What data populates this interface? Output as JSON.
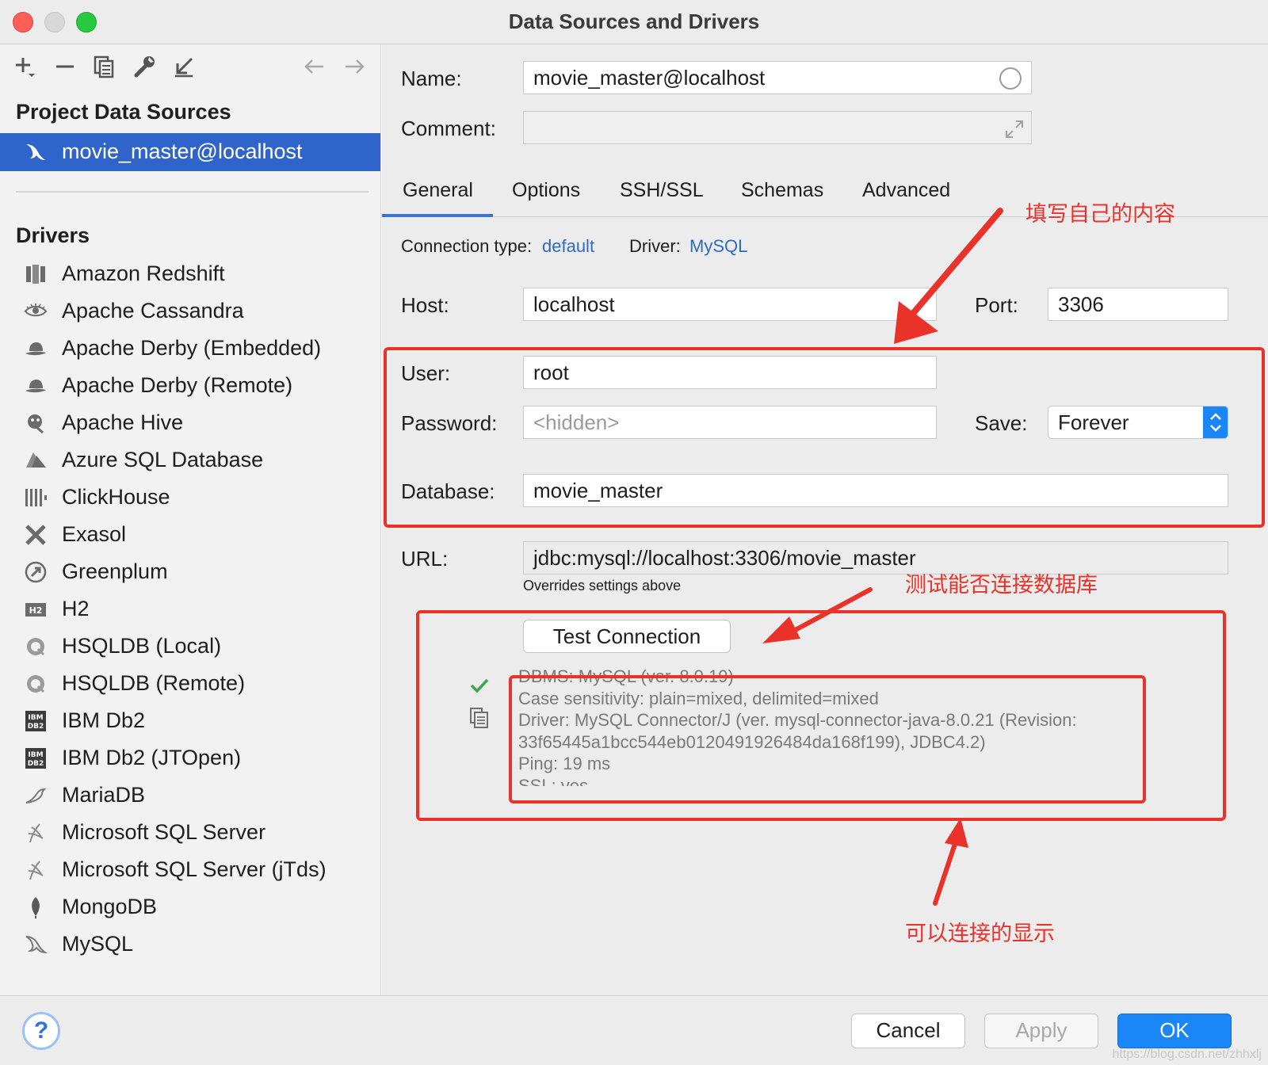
{
  "window": {
    "title": "Data Sources and Drivers"
  },
  "sidebar": {
    "project_header": "Project Data Sources",
    "selected_source": "movie_master@localhost",
    "drivers_header": "Drivers",
    "drivers": [
      {
        "label": "Amazon Redshift",
        "icon": "redshift-icon"
      },
      {
        "label": "Apache Cassandra",
        "icon": "cassandra-eye-icon"
      },
      {
        "label": "Apache Derby (Embedded)",
        "icon": "derby-hat-icon"
      },
      {
        "label": "Apache Derby (Remote)",
        "icon": "derby-hat-icon"
      },
      {
        "label": "Apache Hive",
        "icon": "hive-icon"
      },
      {
        "label": "Azure SQL Database",
        "icon": "azure-icon"
      },
      {
        "label": "ClickHouse",
        "icon": "clickhouse-icon"
      },
      {
        "label": "Exasol",
        "icon": "exasol-icon"
      },
      {
        "label": "Greenplum",
        "icon": "greenplum-icon"
      },
      {
        "label": "H2",
        "icon": "h2-icon"
      },
      {
        "label": "HSQLDB (Local)",
        "icon": "hsqldb-icon"
      },
      {
        "label": "HSQLDB (Remote)",
        "icon": "hsqldb-icon"
      },
      {
        "label": "IBM Db2",
        "icon": "ibm-db2-icon"
      },
      {
        "label": "IBM Db2 (JTOpen)",
        "icon": "ibm-db2-icon"
      },
      {
        "label": "MariaDB",
        "icon": "mariadb-seal-icon"
      },
      {
        "label": "Microsoft SQL Server",
        "icon": "sqlserver-icon"
      },
      {
        "label": "Microsoft SQL Server (jTds)",
        "icon": "sqlserver-icon"
      },
      {
        "label": "MongoDB",
        "icon": "mongodb-leaf-icon"
      },
      {
        "label": "MySQL",
        "icon": "mysql-dolphin-icon"
      }
    ]
  },
  "form": {
    "name_label": "Name:",
    "name_value": "movie_master@localhost",
    "comment_label": "Comment:",
    "comment_value": "",
    "tabs": [
      "General",
      "Options",
      "SSH/SSL",
      "Schemas",
      "Advanced"
    ],
    "active_tab": "General",
    "connection_type_label": "Connection type:",
    "connection_type_value": "default",
    "driver_label": "Driver:",
    "driver_value": "MySQL",
    "host_label": "Host:",
    "host_value": "localhost",
    "port_label": "Port:",
    "port_value": "3306",
    "user_label": "User:",
    "user_value": "root",
    "password_label": "Password:",
    "password_placeholder": "<hidden>",
    "save_label": "Save:",
    "save_value": "Forever",
    "database_label": "Database:",
    "database_value": "movie_master",
    "url_label": "URL:",
    "url_value": "jdbc:mysql://localhost:3306/movie_master",
    "url_note": "Overrides settings above",
    "test_button": "Test Connection"
  },
  "test_result": {
    "lines": [
      "DBMS: MySQL (ver. 8.0.19)",
      "Case sensitivity: plain=mixed, delimited=mixed",
      "Driver: MySQL Connector/J (ver. mysql-connector-java-8.0.21 (Revision:",
      "33f65445a1bcc544eb0120491926484da168f199), JDBC4.2)",
      "Ping: 19 ms",
      "SSL: yes"
    ],
    "status_color": "#3fa34d"
  },
  "annotations": {
    "fill_own": "填写自己的内容",
    "test_conn": "测试能否连接数据库",
    "connectable": "可以连接的显示",
    "color": "#e8322a"
  },
  "footer": {
    "cancel": "Cancel",
    "apply": "Apply",
    "ok": "OK",
    "help": "?",
    "watermark": "https://blog.csdn.net/zhhxlj"
  },
  "colors": {
    "accent": "#2f65ca",
    "link": "#2d6bc4",
    "ok_button": "#1a86f7"
  }
}
